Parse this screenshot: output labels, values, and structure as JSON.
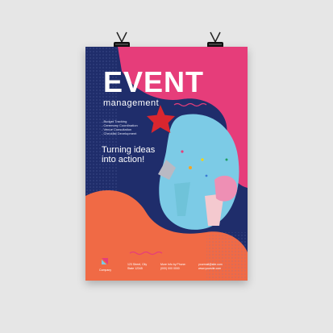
{
  "poster": {
    "title": "EVENT",
    "subtitle": "management",
    "services": [
      "- Budget Tracking",
      "- Ceremony Coordination",
      "- Venue Consultation",
      "- Checklist Development"
    ],
    "tagline": "Turning ideas into action!",
    "logo_label": "Company",
    "footer": {
      "address": [
        "123 Street, City",
        "State 12345"
      ],
      "phone": [
        "More Info by Phone:",
        "(000) 000 0000"
      ],
      "web": [
        "yourmail@site.com",
        "www.yoursite.com"
      ]
    }
  },
  "colors": {
    "navy": "#1f2d6b",
    "pink": "#e63d7a",
    "orange": "#f06a45",
    "sky": "#7ccbe6"
  },
  "icons": [
    "binder-clip-icon",
    "company-logo-icon"
  ]
}
